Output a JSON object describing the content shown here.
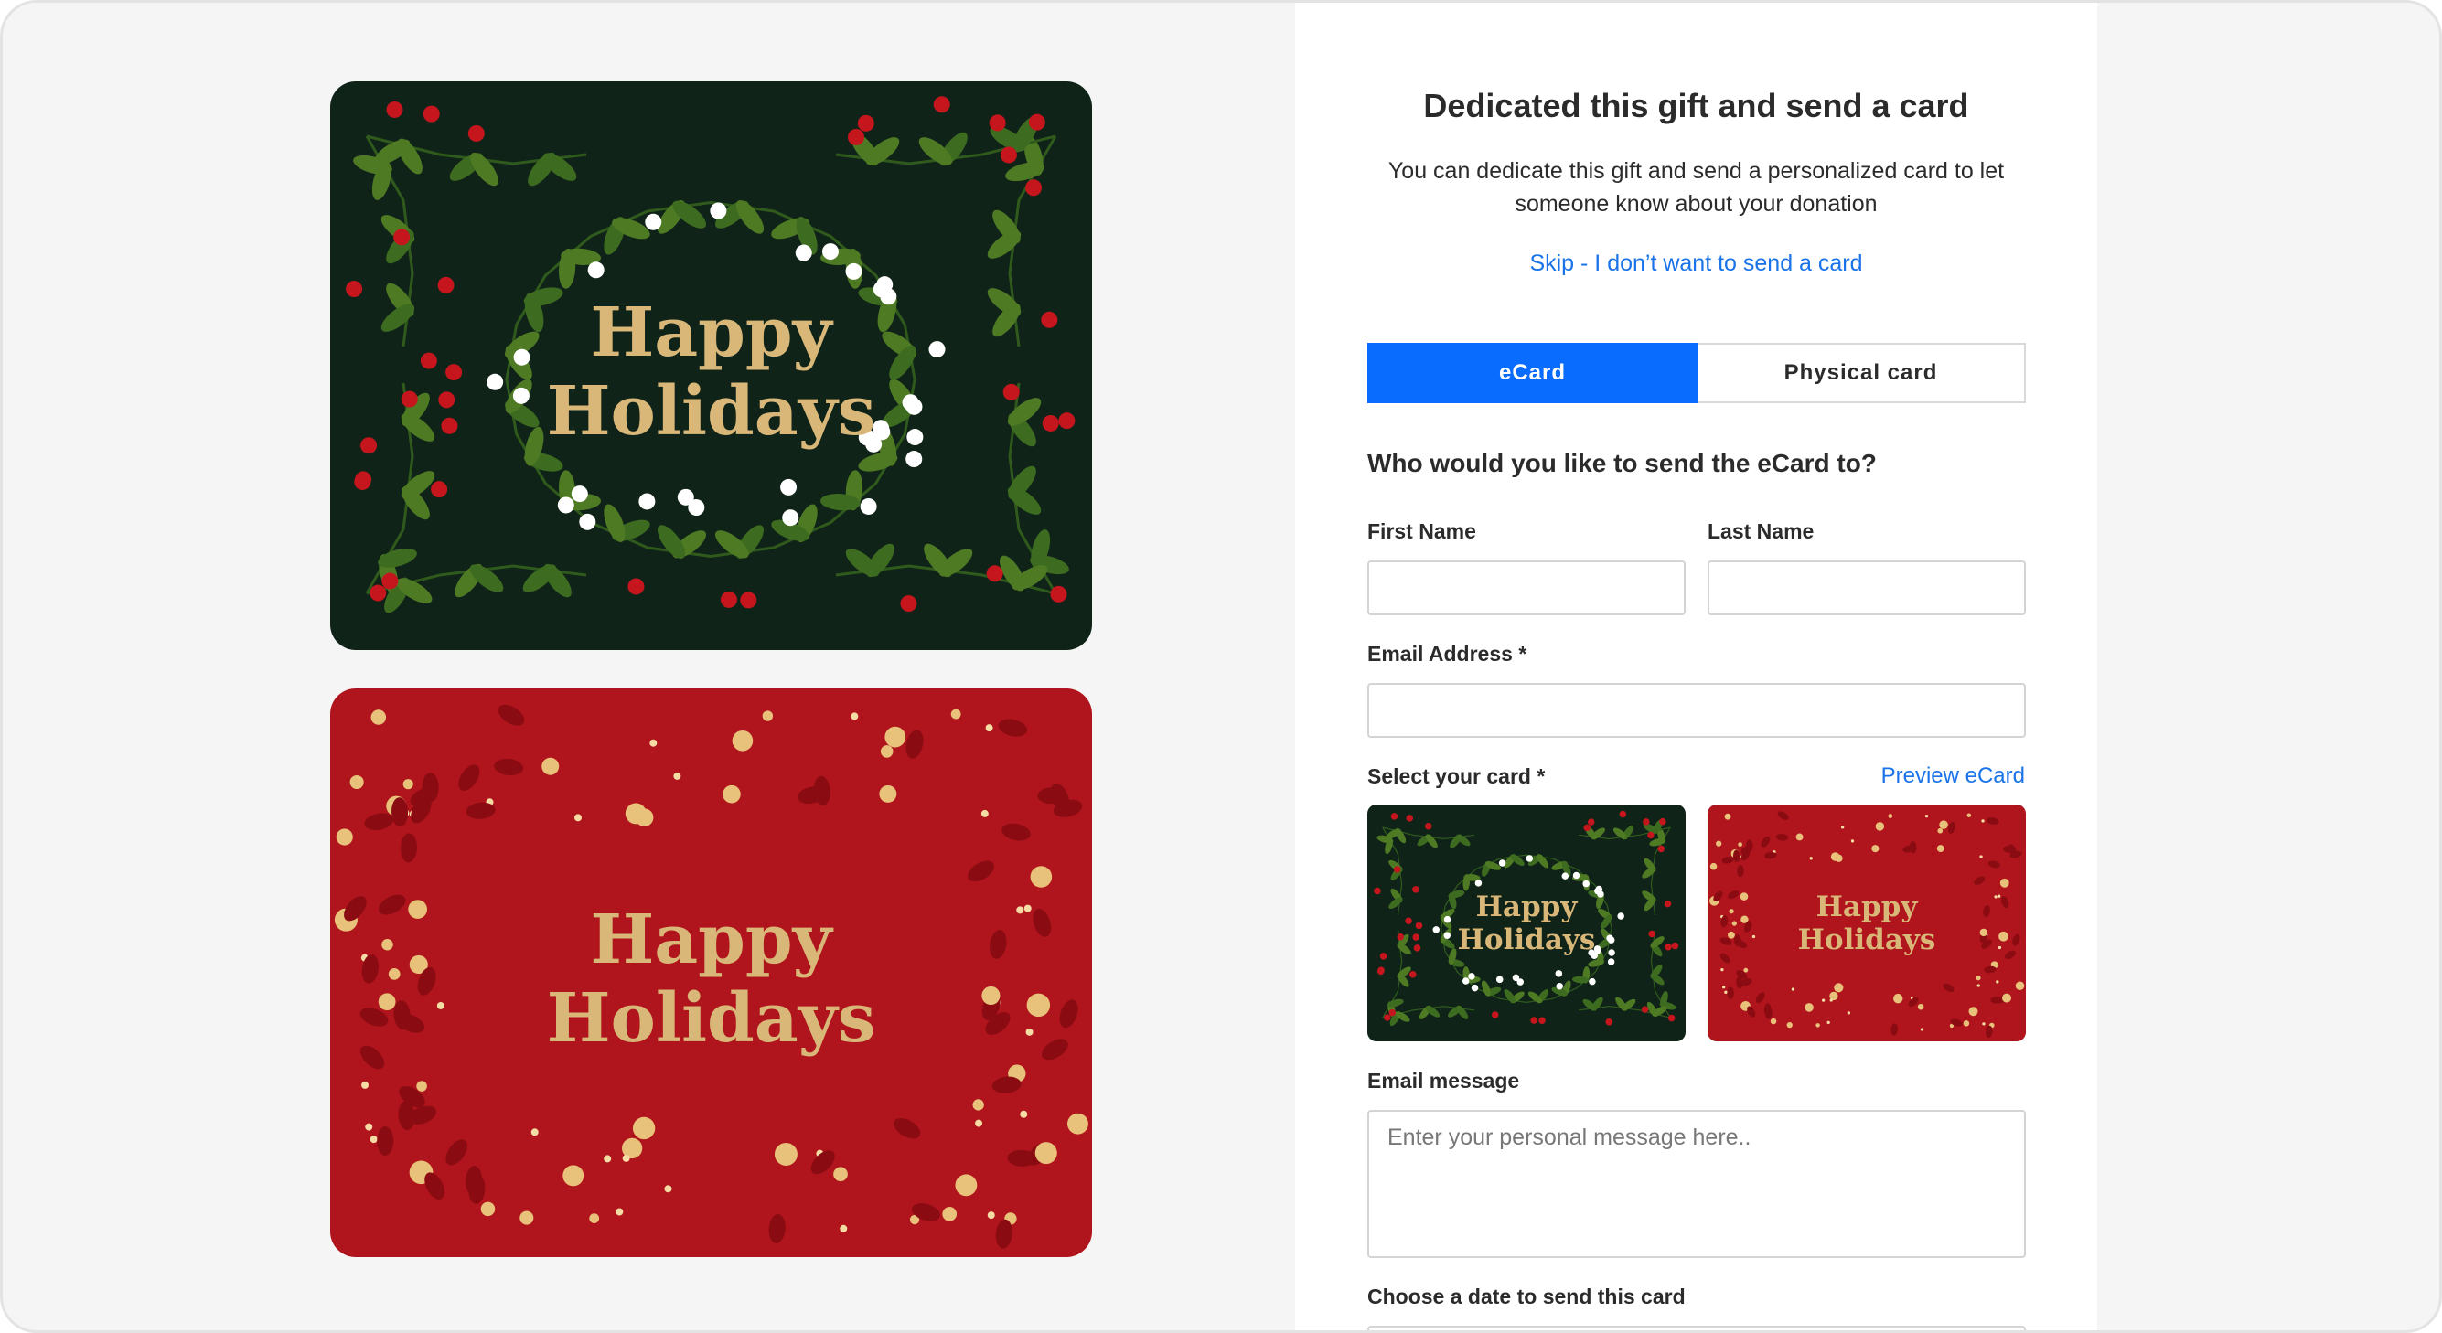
{
  "form": {
    "title": "Dedicated this gift and send a card",
    "subtitle": "You can dedicate this gift and send a personalized card to let someone know about your donation",
    "skip_link": "Skip - I don’t want to send a card",
    "tabs": [
      {
        "label": "eCard",
        "active": true
      },
      {
        "label": "Physical card",
        "active": false
      }
    ],
    "question": "Who would you like to send the eCard to?",
    "first_name": {
      "label": "First Name",
      "value": ""
    },
    "last_name": {
      "label": "Last Name",
      "value": ""
    },
    "email": {
      "label": "Email Address *",
      "value": ""
    },
    "select_card": {
      "label": "Select your card *",
      "preview_link": "Preview eCard"
    },
    "message": {
      "label": "Email message",
      "placeholder": "Enter your personal message here.."
    },
    "date": {
      "label": "Choose a date to send this card"
    }
  },
  "cards": [
    {
      "line1": "Happy",
      "line2": "Holidays",
      "background": "#0f2318",
      "text_color": "#d9b778"
    },
    {
      "line1": "Happy",
      "line2": "Holidays",
      "background": "#b0141c",
      "text_color": "#d9b778"
    }
  ],
  "colors": {
    "accent": "#0a6cff",
    "link": "#1a73e8"
  }
}
